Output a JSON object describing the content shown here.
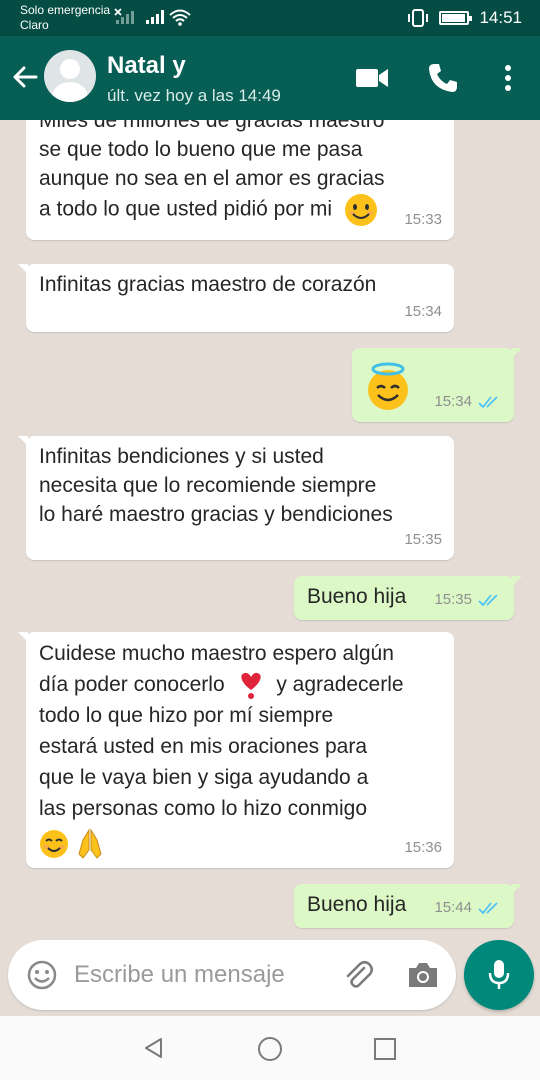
{
  "status_bar": {
    "carrier_line1": "Solo emergencia",
    "carrier_line2": "Claro",
    "time": "14:51"
  },
  "header": {
    "contact_name": "Natal y",
    "last_seen": "últ. vez hoy a las 14:49"
  },
  "messages": [
    {
      "direction": "in",
      "text": "Miles de millones de gracias maestro\nse que todo lo bueno que me pasa\naunque no sea en el amor es gracias\na todo lo que usted pidió por mi",
      "emoji": "smiling-face-icon",
      "time": "15:33"
    },
    {
      "direction": "in",
      "text": "Infinitas gracias maestro de corazón",
      "time": "15:34"
    },
    {
      "direction": "out",
      "text": "",
      "emoji": "smiling-face-with-halo-icon",
      "time": "15:34",
      "status": "read"
    },
    {
      "direction": "in",
      "text": "Infinitas bendiciones y si usted\nnecesita que lo recomiende siempre\nlo haré maestro gracias y bendiciones",
      "time": "15:35"
    },
    {
      "direction": "out",
      "text": "Bueno hija",
      "time": "15:35",
      "status": "read"
    },
    {
      "direction": "in",
      "text_part1": "Cuidese mucho maestro espero algún\ndía poder conocerlo",
      "text_part2": "y agradecerle\ntodo lo que hizo por mí siempre\nestará usted en mis oraciones para\nque le vaya bien y siga ayudando a\nlas personas como lo hizo conmigo",
      "time": "15:36"
    },
    {
      "direction": "out",
      "text": "Bueno hija",
      "time": "15:44",
      "status": "read"
    }
  ],
  "composer": {
    "placeholder": "Escribe un mensaje"
  },
  "colors": {
    "header": "#075e54",
    "status_bar": "#054d44",
    "chat_background": "#e5ddd5",
    "outgoing_bubble": "#dcf8c6",
    "incoming_bubble": "#ffffff",
    "read_ticks": "#4fc3f7",
    "mic_button": "#00897b"
  }
}
